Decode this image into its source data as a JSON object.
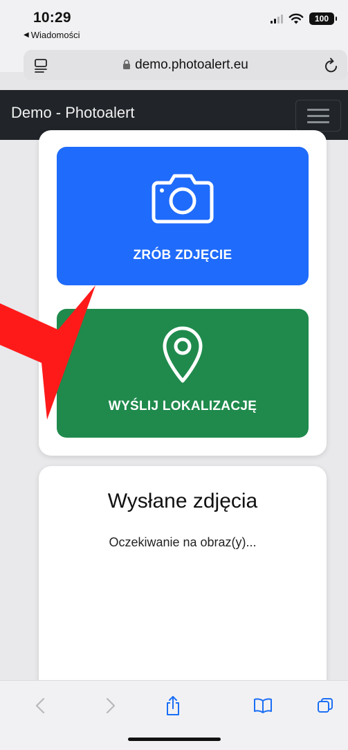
{
  "status_bar": {
    "time": "10:29",
    "back_app": "Wiadomości",
    "battery": "100"
  },
  "browser": {
    "url": "demo.photoalert.eu"
  },
  "navbar": {
    "brand": "Demo - Photoalert"
  },
  "actions": {
    "photo_label": "ZRÓB ZDJĘCIE",
    "location_label": "WYŚLIJ LOKALIZACJĘ"
  },
  "photos": {
    "title": "Wysłane zdjęcia",
    "status": "Oczekiwanie na obraz(y)..."
  },
  "colors": {
    "photo_button": "#1f6bfb",
    "location_button": "#1f8a4c",
    "navbar": "#212529",
    "arrow": "#ff1a1a"
  },
  "icons": {
    "photo": "camera-icon",
    "location": "map-pin-icon",
    "toolbar": [
      "back-icon",
      "forward-icon",
      "share-icon",
      "bookmarks-icon",
      "tabs-icon"
    ]
  }
}
